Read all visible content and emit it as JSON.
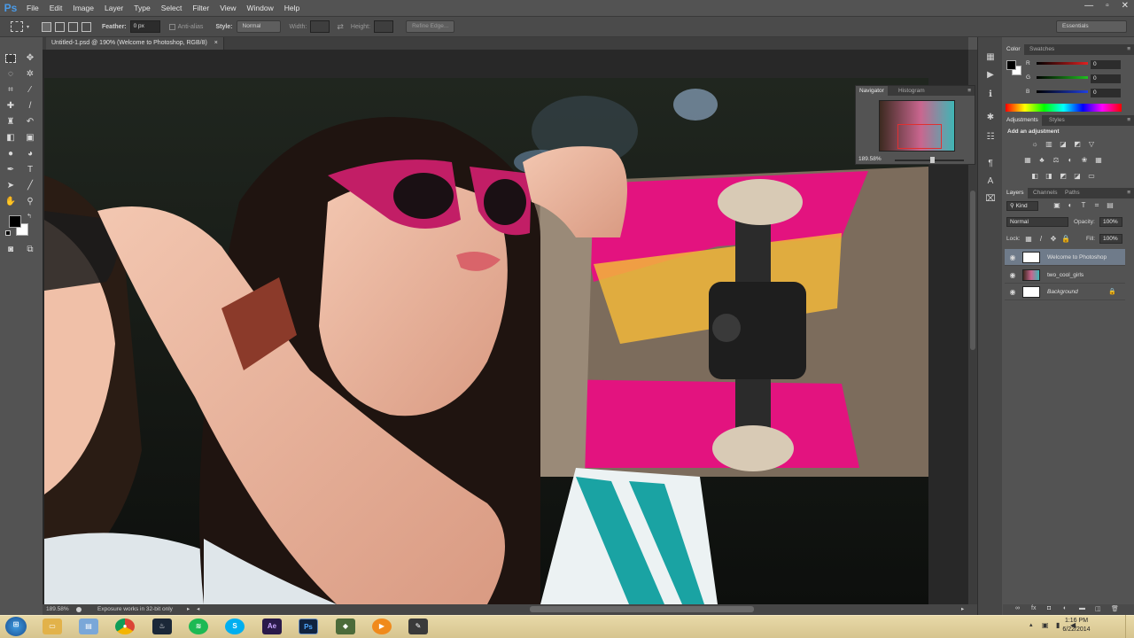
{
  "menu": {
    "logo": "Ps",
    "items": [
      "File",
      "Edit",
      "Image",
      "Layer",
      "Type",
      "Select",
      "Filter",
      "View",
      "Window",
      "Help"
    ]
  },
  "window_controls": {
    "minimize": "—",
    "maximize": "▫",
    "close": "✕"
  },
  "options": {
    "feather_label": "Feather:",
    "feather_value": "0 px",
    "antialias_label": "Anti-alias",
    "style_label": "Style:",
    "style_value": "Normal",
    "width_label": "Width:",
    "height_label": "Height:",
    "refine_edge": "Refine Edge...",
    "workspace": "Essentials"
  },
  "document": {
    "tab_title": "Untitled-1.psd @ 190% (Welcome to Photoshop, RGB/8)",
    "tab_close": "×",
    "zoom": "189.58%",
    "status_info": "Exposure works in 32-bit only"
  },
  "navigator": {
    "tabs": [
      "Navigator",
      "Histogram"
    ],
    "zoom": "189.58%"
  },
  "color_panel": {
    "tabs": [
      "Color",
      "Swatches"
    ],
    "channels": [
      {
        "label": "R",
        "value": "0",
        "color": "#e02020"
      },
      {
        "label": "G",
        "value": "0",
        "color": "#20c020"
      },
      {
        "label": "B",
        "value": "0",
        "color": "#2040e0"
      }
    ]
  },
  "adjustments": {
    "tabs": [
      "Adjustments",
      "Styles"
    ],
    "heading": "Add an adjustment"
  },
  "layers_panel": {
    "tabs": [
      "Layers",
      "Channels",
      "Paths"
    ],
    "filter_kind": "Kind",
    "blend_mode": "Normal",
    "opacity_label": "Opacity:",
    "opacity_value": "100%",
    "lock_label": "Lock:",
    "fill_label": "Fill:",
    "fill_value": "100%",
    "layers": [
      {
        "name": "Welcome to Photoshop",
        "selected": true
      },
      {
        "name": "two_cool_girls",
        "selected": false
      },
      {
        "name": "Background",
        "selected": false
      }
    ]
  },
  "taskbar": {
    "time": "1:16 PM",
    "date": "6/22/2014"
  }
}
